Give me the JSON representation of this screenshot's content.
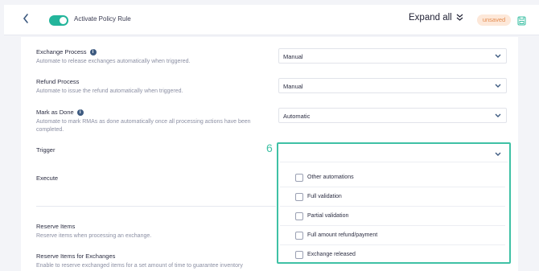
{
  "header": {
    "toggle_label": "Activate Policy Rule",
    "expand_label": "Expand all",
    "status_badge": "unsaved"
  },
  "rules": [
    {
      "label": "Exchange Process",
      "desc": "Automate to release exchanges automatically when triggered.",
      "value": "Manual"
    },
    {
      "label": "Refund Process",
      "desc": "Automate to issue the refund automatically when triggered.",
      "value": "Manual"
    },
    {
      "label": "Mark as Done",
      "desc": "Automate to mark RMAs as done automatically once all processing actions have been completed.",
      "value": "Automatic"
    }
  ],
  "trigger": {
    "label": "Trigger",
    "step_number": "6",
    "options": [
      "Other automations",
      "Full validation",
      "Partial validation",
      "Full amount refund/payment",
      "Exchange released"
    ]
  },
  "execute": {
    "label": "Execute"
  },
  "reserve_items": {
    "label": "Reserve Items",
    "desc": "Reserve items when processing an exchange."
  },
  "reserve_exchanges": {
    "label": "Reserve Items for Exchanges",
    "desc": "Enable to reserve exchanged items for a set amount of time to guarantee inventory"
  },
  "colors": {
    "accent": "#3fc1a5",
    "toggle": "#23b59b",
    "badge_bg": "#fde8d9",
    "badge_text": "#e38b4f",
    "link": "#3d5a80"
  }
}
